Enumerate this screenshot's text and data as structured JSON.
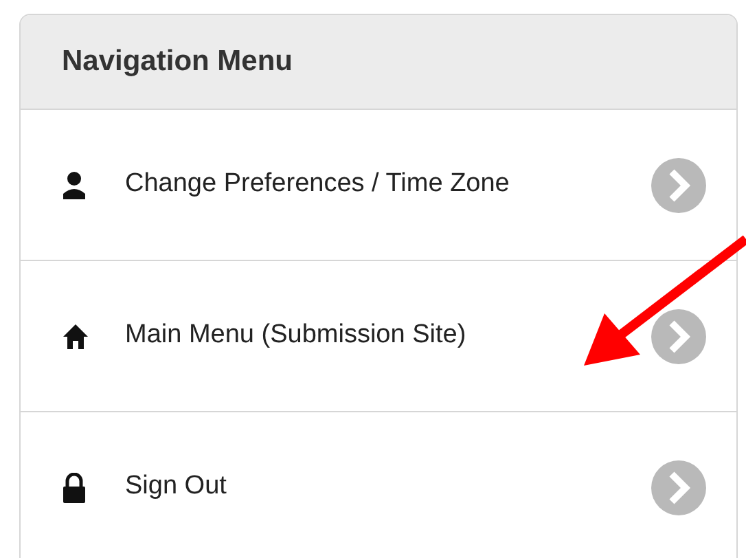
{
  "menu": {
    "title": "Navigation Menu",
    "items": [
      {
        "label": "Change Preferences / Time Zone",
        "kind": "user"
      },
      {
        "label": "Main Menu (Submission Site)",
        "kind": "home"
      },
      {
        "label": "Sign Out",
        "kind": "lock"
      }
    ]
  }
}
